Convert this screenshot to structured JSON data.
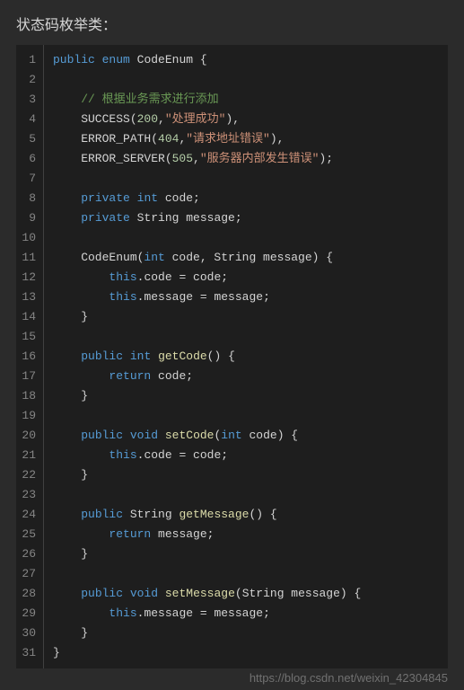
{
  "title": "状态码枚举类：",
  "watermark": "https://blog.csdn.net/weixin_42304845",
  "code": {
    "lines": [
      {
        "n": "1",
        "tokens": [
          {
            "t": "kw",
            "v": "public"
          },
          {
            "t": "sp",
            "v": " "
          },
          {
            "t": "kw",
            "v": "enum"
          },
          {
            "t": "sp",
            "v": " "
          },
          {
            "t": "cls",
            "v": "CodeEnum"
          },
          {
            "t": "sp",
            "v": " {"
          }
        ]
      },
      {
        "n": "2",
        "tokens": []
      },
      {
        "n": "3",
        "tokens": [
          {
            "t": "sp",
            "v": "    "
          },
          {
            "t": "com",
            "v": "// 根据业务需求进行添加"
          }
        ]
      },
      {
        "n": "4",
        "tokens": [
          {
            "t": "sp",
            "v": "    SUCCESS("
          },
          {
            "t": "num",
            "v": "200"
          },
          {
            "t": "sp",
            "v": ","
          },
          {
            "t": "str",
            "v": "\"处理成功\""
          },
          {
            "t": "sp",
            "v": "),"
          }
        ]
      },
      {
        "n": "5",
        "tokens": [
          {
            "t": "sp",
            "v": "    ERROR_PATH("
          },
          {
            "t": "num",
            "v": "404"
          },
          {
            "t": "sp",
            "v": ","
          },
          {
            "t": "str",
            "v": "\"请求地址错误\""
          },
          {
            "t": "sp",
            "v": "),"
          }
        ]
      },
      {
        "n": "6",
        "tokens": [
          {
            "t": "sp",
            "v": "    ERROR_SERVER("
          },
          {
            "t": "num",
            "v": "505"
          },
          {
            "t": "sp",
            "v": ","
          },
          {
            "t": "str",
            "v": "\"服务器内部发生错误\""
          },
          {
            "t": "sp",
            "v": ");"
          }
        ]
      },
      {
        "n": "7",
        "tokens": []
      },
      {
        "n": "8",
        "tokens": [
          {
            "t": "sp",
            "v": "    "
          },
          {
            "t": "kw",
            "v": "private"
          },
          {
            "t": "sp",
            "v": " "
          },
          {
            "t": "kw",
            "v": "int"
          },
          {
            "t": "sp",
            "v": " code;"
          }
        ]
      },
      {
        "n": "9",
        "tokens": [
          {
            "t": "sp",
            "v": "    "
          },
          {
            "t": "kw",
            "v": "private"
          },
          {
            "t": "sp",
            "v": " String message;"
          }
        ]
      },
      {
        "n": "10",
        "tokens": []
      },
      {
        "n": "11",
        "tokens": [
          {
            "t": "sp",
            "v": "    CodeEnum("
          },
          {
            "t": "kw",
            "v": "int"
          },
          {
            "t": "sp",
            "v": " code, String message) {"
          }
        ]
      },
      {
        "n": "12",
        "tokens": [
          {
            "t": "sp",
            "v": "        "
          },
          {
            "t": "kw",
            "v": "this"
          },
          {
            "t": "sp",
            "v": ".code = code;"
          }
        ]
      },
      {
        "n": "13",
        "tokens": [
          {
            "t": "sp",
            "v": "        "
          },
          {
            "t": "kw",
            "v": "this"
          },
          {
            "t": "sp",
            "v": ".message = message;"
          }
        ]
      },
      {
        "n": "14",
        "tokens": [
          {
            "t": "sp",
            "v": "    }"
          }
        ]
      },
      {
        "n": "15",
        "tokens": []
      },
      {
        "n": "16",
        "tokens": [
          {
            "t": "sp",
            "v": "    "
          },
          {
            "t": "kw",
            "v": "public"
          },
          {
            "t": "sp",
            "v": " "
          },
          {
            "t": "kw",
            "v": "int"
          },
          {
            "t": "sp",
            "v": " "
          },
          {
            "t": "fn",
            "v": "getCode"
          },
          {
            "t": "sp",
            "v": "() {"
          }
        ]
      },
      {
        "n": "17",
        "tokens": [
          {
            "t": "sp",
            "v": "        "
          },
          {
            "t": "kw",
            "v": "return"
          },
          {
            "t": "sp",
            "v": " code;"
          }
        ]
      },
      {
        "n": "18",
        "tokens": [
          {
            "t": "sp",
            "v": "    }"
          }
        ]
      },
      {
        "n": "19",
        "tokens": []
      },
      {
        "n": "20",
        "tokens": [
          {
            "t": "sp",
            "v": "    "
          },
          {
            "t": "kw",
            "v": "public"
          },
          {
            "t": "sp",
            "v": " "
          },
          {
            "t": "kw",
            "v": "void"
          },
          {
            "t": "sp",
            "v": " "
          },
          {
            "t": "fn",
            "v": "setCode"
          },
          {
            "t": "sp",
            "v": "("
          },
          {
            "t": "kw",
            "v": "int"
          },
          {
            "t": "sp",
            "v": " code) {"
          }
        ]
      },
      {
        "n": "21",
        "tokens": [
          {
            "t": "sp",
            "v": "        "
          },
          {
            "t": "kw",
            "v": "this"
          },
          {
            "t": "sp",
            "v": ".code = code;"
          }
        ]
      },
      {
        "n": "22",
        "tokens": [
          {
            "t": "sp",
            "v": "    }"
          }
        ]
      },
      {
        "n": "23",
        "tokens": []
      },
      {
        "n": "24",
        "tokens": [
          {
            "t": "sp",
            "v": "    "
          },
          {
            "t": "kw",
            "v": "public"
          },
          {
            "t": "sp",
            "v": " String "
          },
          {
            "t": "fn",
            "v": "getMessage"
          },
          {
            "t": "sp",
            "v": "() {"
          }
        ]
      },
      {
        "n": "25",
        "tokens": [
          {
            "t": "sp",
            "v": "        "
          },
          {
            "t": "kw",
            "v": "return"
          },
          {
            "t": "sp",
            "v": " message;"
          }
        ]
      },
      {
        "n": "26",
        "tokens": [
          {
            "t": "sp",
            "v": "    }"
          }
        ]
      },
      {
        "n": "27",
        "tokens": []
      },
      {
        "n": "28",
        "tokens": [
          {
            "t": "sp",
            "v": "    "
          },
          {
            "t": "kw",
            "v": "public"
          },
          {
            "t": "sp",
            "v": " "
          },
          {
            "t": "kw",
            "v": "void"
          },
          {
            "t": "sp",
            "v": " "
          },
          {
            "t": "fn",
            "v": "setMessage"
          },
          {
            "t": "sp",
            "v": "(String message) {"
          }
        ]
      },
      {
        "n": "29",
        "tokens": [
          {
            "t": "sp",
            "v": "        "
          },
          {
            "t": "kw",
            "v": "this"
          },
          {
            "t": "sp",
            "v": ".message = message;"
          }
        ]
      },
      {
        "n": "30",
        "tokens": [
          {
            "t": "sp",
            "v": "    }"
          }
        ]
      },
      {
        "n": "31",
        "tokens": [
          {
            "t": "sp",
            "v": "}"
          }
        ]
      }
    ]
  }
}
